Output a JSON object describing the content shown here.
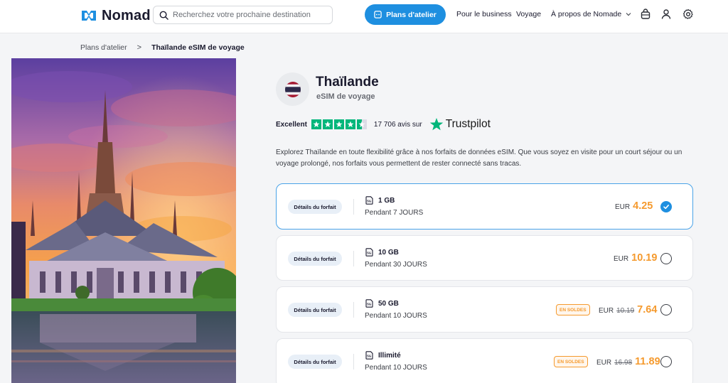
{
  "header": {
    "logo_text": "Nomad",
    "search_placeholder": "Recherchez votre prochaine destination",
    "primary_button": "Plans d'atelier",
    "nav": [
      "Pour le business",
      "Voyage",
      "À propos de Nomade"
    ],
    "accent_color": "#1e8fe0"
  },
  "breadcrumb": {
    "parent": "Plans d'atelier",
    "separator": ">",
    "current": "Thaïlande eSIM de voyage"
  },
  "country": {
    "title": "Thaïlande",
    "subtitle": "eSIM de voyage"
  },
  "trustpilot": {
    "rating_label": "Excellent",
    "rating_stars": 4.5,
    "reviews_text": "17 706 avis sur",
    "brand": "Trustpilot"
  },
  "description": "Explorez Thaïlande en toute flexibilité grâce à nos forfaits de données eSIM. Que vous soyez en visite pour un court séjour ou un voyage prolongé, nos forfaits vous permettent de rester connecté sans tracas.",
  "plans": [
    {
      "details_label": "Détails du forfait",
      "data": "1 GB",
      "duration": "Pendant 7 JOURS",
      "currency": "EUR",
      "price": "4.25",
      "old_price": "",
      "sale": "",
      "selected": true
    },
    {
      "details_label": "Détails du forfait",
      "data": "10 GB",
      "duration": "Pendant 30 JOURS",
      "currency": "EUR",
      "price": "10.19",
      "old_price": "",
      "sale": "",
      "selected": false
    },
    {
      "details_label": "Détails du forfait",
      "data": "50 GB",
      "duration": "Pendant 10 JOURS",
      "currency": "EUR",
      "price": "7.64",
      "old_price": "10.19",
      "sale": "EN SOLDES",
      "selected": false
    },
    {
      "details_label": "Détails du forfait",
      "data": "Illimité",
      "duration": "Pendant 10 JOURS",
      "currency": "EUR",
      "price": "11.89",
      "old_price": "16.98",
      "sale": "EN SOLDES",
      "selected": false
    }
  ],
  "sim_icon_label": "5G",
  "colors": {
    "price": "#f59a2e",
    "trust_green": "#00b67a",
    "selected_border": "#4aa3e8"
  }
}
